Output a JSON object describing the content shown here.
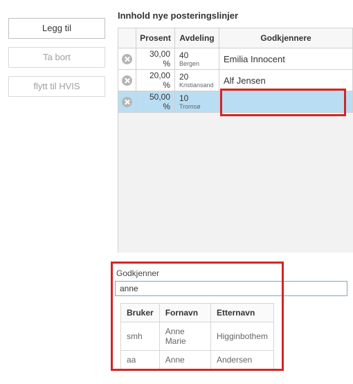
{
  "buttons": {
    "add": "Legg til",
    "remove": "Ta bort",
    "move_to_hvis": "flytt til HVIS"
  },
  "section_title": "Innhold nye posteringslinjer",
  "grid": {
    "headers": {
      "prosent": "Prosent",
      "avdeling": "Avdeling",
      "godkjennere": "Godkjennere"
    },
    "rows": [
      {
        "prosent": "30,00 %",
        "avd_code": "40",
        "avd_name": "Bergen",
        "godkjenner": "Emilia Innocent",
        "selected": false
      },
      {
        "prosent": "20,00 %",
        "avd_code": "20",
        "avd_name": "Kristiansand",
        "godkjenner": "Alf Jensen",
        "selected": false
      },
      {
        "prosent": "50,00 %",
        "avd_code": "10",
        "avd_name": "Tromsø",
        "godkjenner": "",
        "selected": true
      }
    ]
  },
  "search": {
    "label": "Godkjenner",
    "value": "anne",
    "columns": {
      "bruker": "Bruker",
      "fornavn": "Fornavn",
      "etternavn": "Etternavn"
    },
    "results": [
      {
        "bruker": "smh",
        "fornavn": "Anne Marie",
        "etternavn": "Higginbothem"
      },
      {
        "bruker": "aa",
        "fornavn": "Anne",
        "etternavn": "Andersen"
      }
    ]
  }
}
